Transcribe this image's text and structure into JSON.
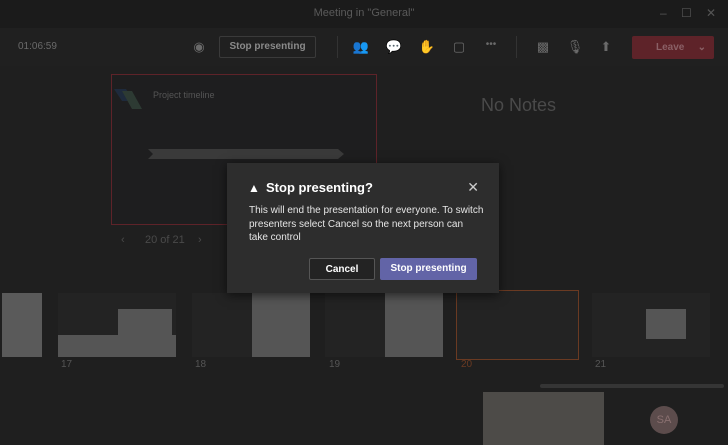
{
  "window": {
    "title": "Meeting in \"General\"",
    "minimize": "–",
    "maximize": "☐",
    "close": "✕"
  },
  "toolbar": {
    "timer": "01:06:59",
    "stop_presenting": "Stop presenting",
    "leave": "Leave",
    "more": "•••"
  },
  "presenter": {
    "slide_title": "Project timeline",
    "notes": "No Notes",
    "counter": "20 of 21",
    "prev": "‹",
    "next": "›"
  },
  "thumbnails": [
    {
      "number": "17"
    },
    {
      "number": "18"
    },
    {
      "number": "19"
    },
    {
      "number": "20",
      "selected": true
    },
    {
      "number": "21"
    }
  ],
  "participants": {
    "avatar_initials": "SA"
  },
  "dialog": {
    "title": "Stop presenting?",
    "body": "This will end the presentation for everyone. To switch presenters select Cancel so the next person can take control",
    "cancel": "Cancel",
    "confirm": "Stop presenting",
    "close": "✕",
    "warning": "▲"
  },
  "colors": {
    "accent": "#6264a7",
    "leave": "#c4314b",
    "selected": "#e97548"
  }
}
